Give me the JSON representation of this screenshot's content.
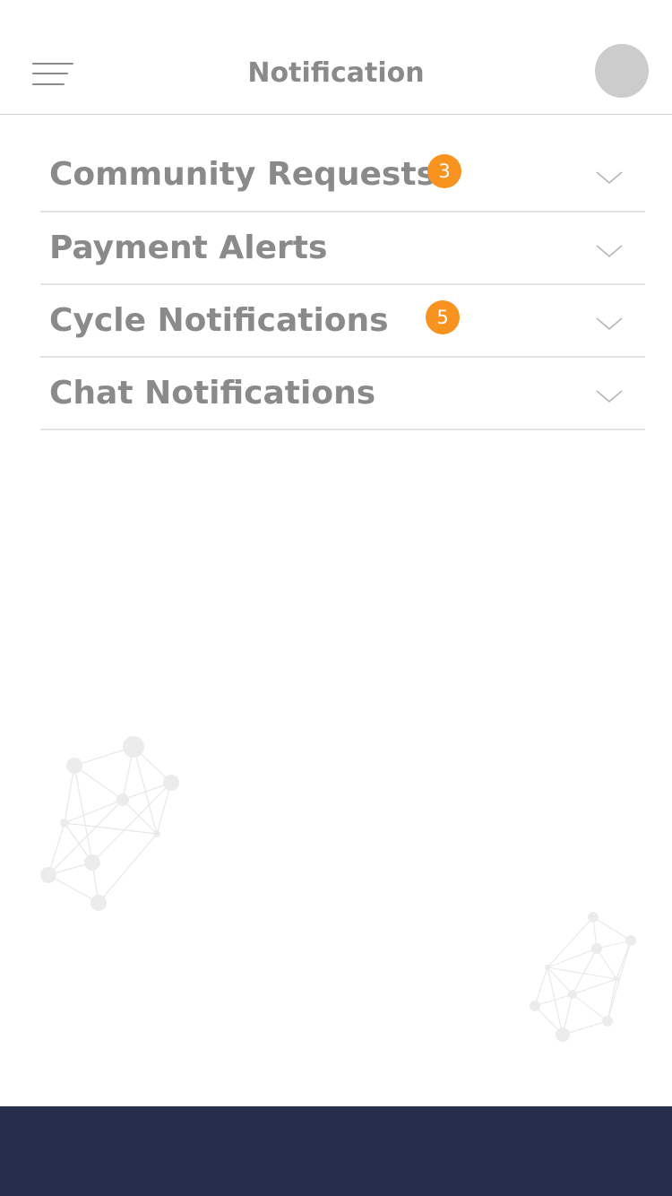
{
  "header": {
    "title": "Notification"
  },
  "notifications": [
    {
      "label": "Community Requests",
      "badge": "3"
    },
    {
      "label": "Payment Alerts",
      "badge": ""
    },
    {
      "label": "Cycle Notifications",
      "badge": "5"
    },
    {
      "label": "Chat Notifications",
      "badge": ""
    }
  ],
  "icons": {
    "menu": "hamburger-menu-icon",
    "avatar": "user-avatar",
    "expand": "chevron-down-icon"
  },
  "colors": {
    "text": "#8a8a8a",
    "badge": "#f7931e",
    "footer": "#262e4b",
    "avatar": "#cccccc"
  }
}
